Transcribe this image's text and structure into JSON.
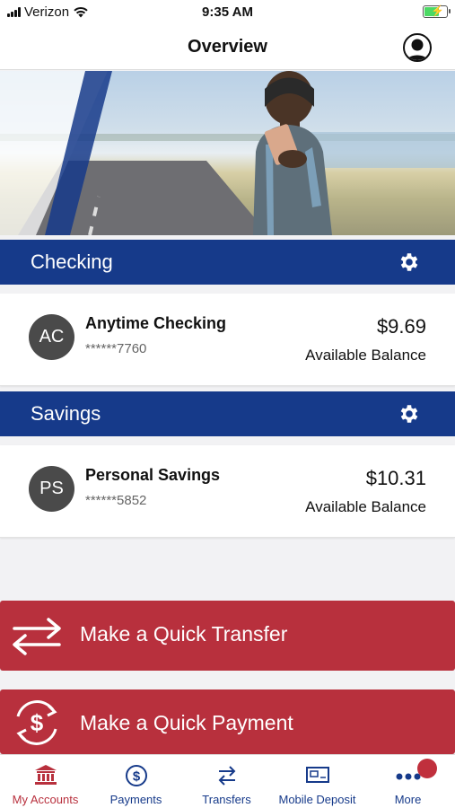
{
  "status_bar": {
    "carrier": "Verizon",
    "time": "9:35 AM",
    "battery_level": 0.7
  },
  "header": {
    "title": "Overview",
    "profile_icon": "person-circle-icon"
  },
  "sections": [
    {
      "title": "Checking",
      "settings_icon": "gear-icon",
      "account": {
        "initials": "AC",
        "name": "Anytime Checking",
        "number": "******7760",
        "amount": "$9.69",
        "amount_label": "Available Balance"
      }
    },
    {
      "title": "Savings",
      "settings_icon": "gear-icon",
      "account": {
        "initials": "PS",
        "name": "Personal Savings",
        "number": "******5852",
        "amount": "$10.31",
        "amount_label": "Available Balance"
      }
    }
  ],
  "actions": {
    "transfer_label": "Make a Quick Transfer",
    "payment_label": "Make a Quick Payment"
  },
  "tab_bar": {
    "items": [
      {
        "label": "My Accounts",
        "icon": "bank-icon",
        "active": true
      },
      {
        "label": "Payments",
        "icon": "dollar-circle-icon",
        "active": false
      },
      {
        "label": "Transfers",
        "icon": "transfer-arrows-icon",
        "active": false
      },
      {
        "label": "Mobile Deposit",
        "icon": "check-deposit-icon",
        "active": false
      },
      {
        "label": "More",
        "icon": "more-dots-icon",
        "active": false
      }
    ]
  },
  "colors": {
    "primary_blue": "#163a8a",
    "accent_red": "#b8303d",
    "background": "#f2f2f4"
  }
}
